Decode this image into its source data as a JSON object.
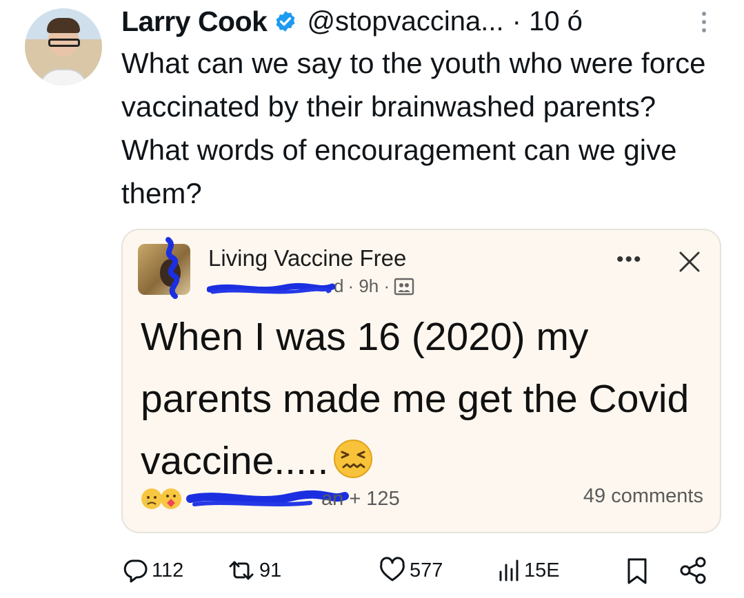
{
  "tweet": {
    "author_name": "Larry Cook",
    "handle": "@stopvaccina...",
    "time": "· 10 ó",
    "text": "What can we say to the youth who were force vaccinated by their brainwashed parents? What words of encouragement can we give them?"
  },
  "embedded_post": {
    "group_name": "Living Vaccine Free",
    "author_suffix": "d",
    "time": "· 9h ·",
    "body": "When I was 16 (2020) my parents made me get the Covid vaccine.....",
    "reaction_count": "an + 125",
    "comments": "49 comments"
  },
  "actions": {
    "replies": "112",
    "reposts": "91",
    "likes": "577",
    "views": "15E"
  },
  "colors": {
    "verified_blue": "#1d9bf0",
    "card_bg": "#fdf7ef",
    "redaction_blue": "#1b2fe0"
  },
  "icons": [
    "verified-badge-icon",
    "more-vertical-icon",
    "more-horizontal-icon",
    "close-icon",
    "group-icon",
    "reply-icon",
    "repost-icon",
    "like-icon",
    "views-icon",
    "bookmark-icon",
    "share-icon",
    "sad-emoji-icon",
    "care-emoji-icon",
    "confounded-emoji-icon"
  ]
}
